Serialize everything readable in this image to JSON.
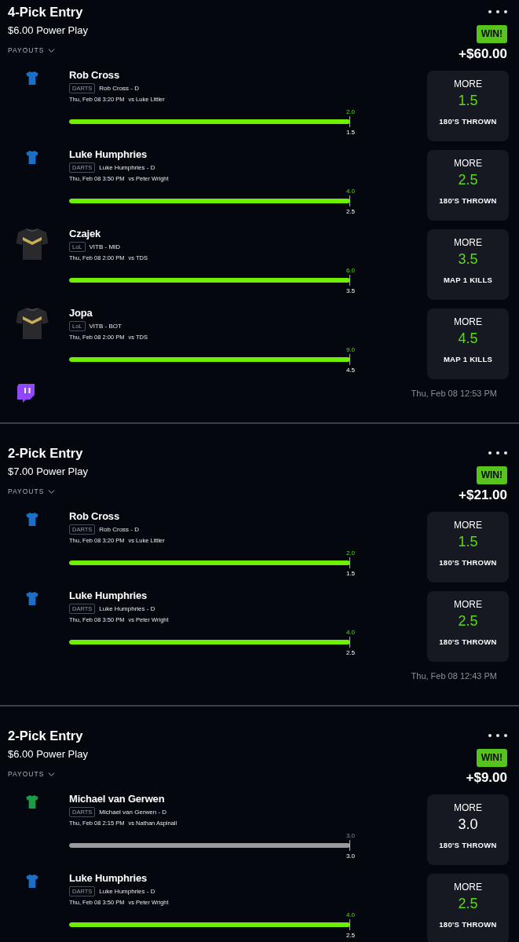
{
  "entries": [
    {
      "title": "4-Pick Entry",
      "stake": "$6.00 Power Play",
      "payouts_label": "PAYOUTS",
      "result_badge": "WIN!",
      "payout": "+$60.00",
      "stream": true,
      "timestamp": "Thu, Feb 08 12:53 PM",
      "picks": [
        {
          "player": "Rob Cross",
          "league": "DARTS",
          "team": "Rob Cross - D",
          "time": "Thu, Feb 08 3:20 PM",
          "opponent": "vs Luke Littler",
          "actual": "2.0",
          "level": 1,
          "line": "1.5",
          "kind": "win",
          "jersey": {
            "kind": "tee",
            "color": "#1b6fc6"
          },
          "card": {
            "direction": "MORE",
            "value": "1.5",
            "stat": "180'S THROWN"
          }
        },
        {
          "player": "Luke Humphries",
          "league": "DARTS",
          "team": "Luke Humphries - D",
          "time": "Thu, Feb 08 3:50 PM",
          "opponent": "vs Peter Wright",
          "actual": "4.0",
          "level": 1,
          "line": "2.5",
          "kind": "win",
          "jersey": {
            "kind": "tee",
            "color": "#1b6fc6"
          },
          "card": {
            "direction": "MORE",
            "value": "2.5",
            "stat": "180'S THROWN"
          }
        },
        {
          "player": "Czajek",
          "league": "LoL",
          "team": "VITB - MID",
          "time": "Thu, Feb 08 2:00 PM",
          "opponent": "vs TDS",
          "actual": "6.0",
          "level": 1,
          "line": "3.5",
          "kind": "win",
          "jersey": {
            "kind": "kit",
            "color": "#2a2a2c"
          },
          "card": {
            "direction": "MORE",
            "value": "3.5",
            "stat": "MAP 1 KILLS"
          }
        },
        {
          "player": "Jopa",
          "league": "LoL",
          "team": "VITB - BOT",
          "time": "Thu, Feb 08 2:00 PM",
          "opponent": "vs TDS",
          "actual": "9.0",
          "level": 1,
          "line": "4.5",
          "kind": "win",
          "jersey": {
            "kind": "kit",
            "color": "#2a2a2c"
          },
          "card": {
            "direction": "MORE",
            "value": "4.5",
            "stat": "MAP 1 KILLS"
          }
        }
      ]
    },
    {
      "title": "2-Pick Entry",
      "stake": "$7.00 Power Play",
      "payouts_label": "PAYOUTS",
      "result_badge": "WIN!",
      "payout": "+$21.00",
      "timestamp": "Thu, Feb 08 12:43 PM",
      "picks": [
        {
          "player": "Rob Cross",
          "league": "DARTS",
          "team": "Rob Cross - D",
          "time": "Thu, Feb 08 3:20 PM",
          "opponent": "vs Luke Littler",
          "actual": "2.0",
          "level": 1,
          "line": "1.5",
          "kind": "win",
          "jersey": {
            "kind": "tee",
            "color": "#1b6fc6"
          },
          "card": {
            "direction": "MORE",
            "value": "1.5",
            "stat": "180'S THROWN"
          }
        },
        {
          "player": "Luke Humphries",
          "league": "DARTS",
          "team": "Luke Humphries - D",
          "time": "Thu, Feb 08 3:50 PM",
          "opponent": "vs Peter Wright",
          "actual": "4.0",
          "level": 1,
          "line": "2.5",
          "kind": "win",
          "jersey": {
            "kind": "tee",
            "color": "#1b6fc6"
          },
          "card": {
            "direction": "MORE",
            "value": "2.5",
            "stat": "180'S THROWN"
          }
        }
      ]
    },
    {
      "title": "2-Pick Entry",
      "stake": "$6.00 Power Play",
      "payouts_label": "PAYOUTS",
      "result_badge": "WIN!",
      "payout": "+$9.00",
      "picks": [
        {
          "player": "Michael van Gerwen",
          "league": "DARTS",
          "team": "Michael van Gerwen - D",
          "time": "Thu, Feb 08 2:15 PM",
          "opponent": "vs Nathan Aspinall",
          "actual": "3.0",
          "level": 1,
          "line": "3.0",
          "kind": "push",
          "jersey": {
            "kind": "tee",
            "color": "#1d9a45"
          },
          "card": {
            "direction": "MORE",
            "value": "3.0",
            "stat": "180'S THROWN"
          }
        },
        {
          "player": "Luke Humphries",
          "league": "DARTS",
          "team": "Luke Humphries - D",
          "time": "Thu, Feb 08 3:50 PM",
          "opponent": "vs Peter Wright",
          "actual": "4.0",
          "level": 1,
          "line": "2.5",
          "kind": "win",
          "jersey": {
            "kind": "tee",
            "color": "#1b6fc6"
          },
          "card": {
            "direction": "MORE",
            "value": "2.5",
            "stat": "180'S THROWN"
          }
        }
      ]
    }
  ]
}
